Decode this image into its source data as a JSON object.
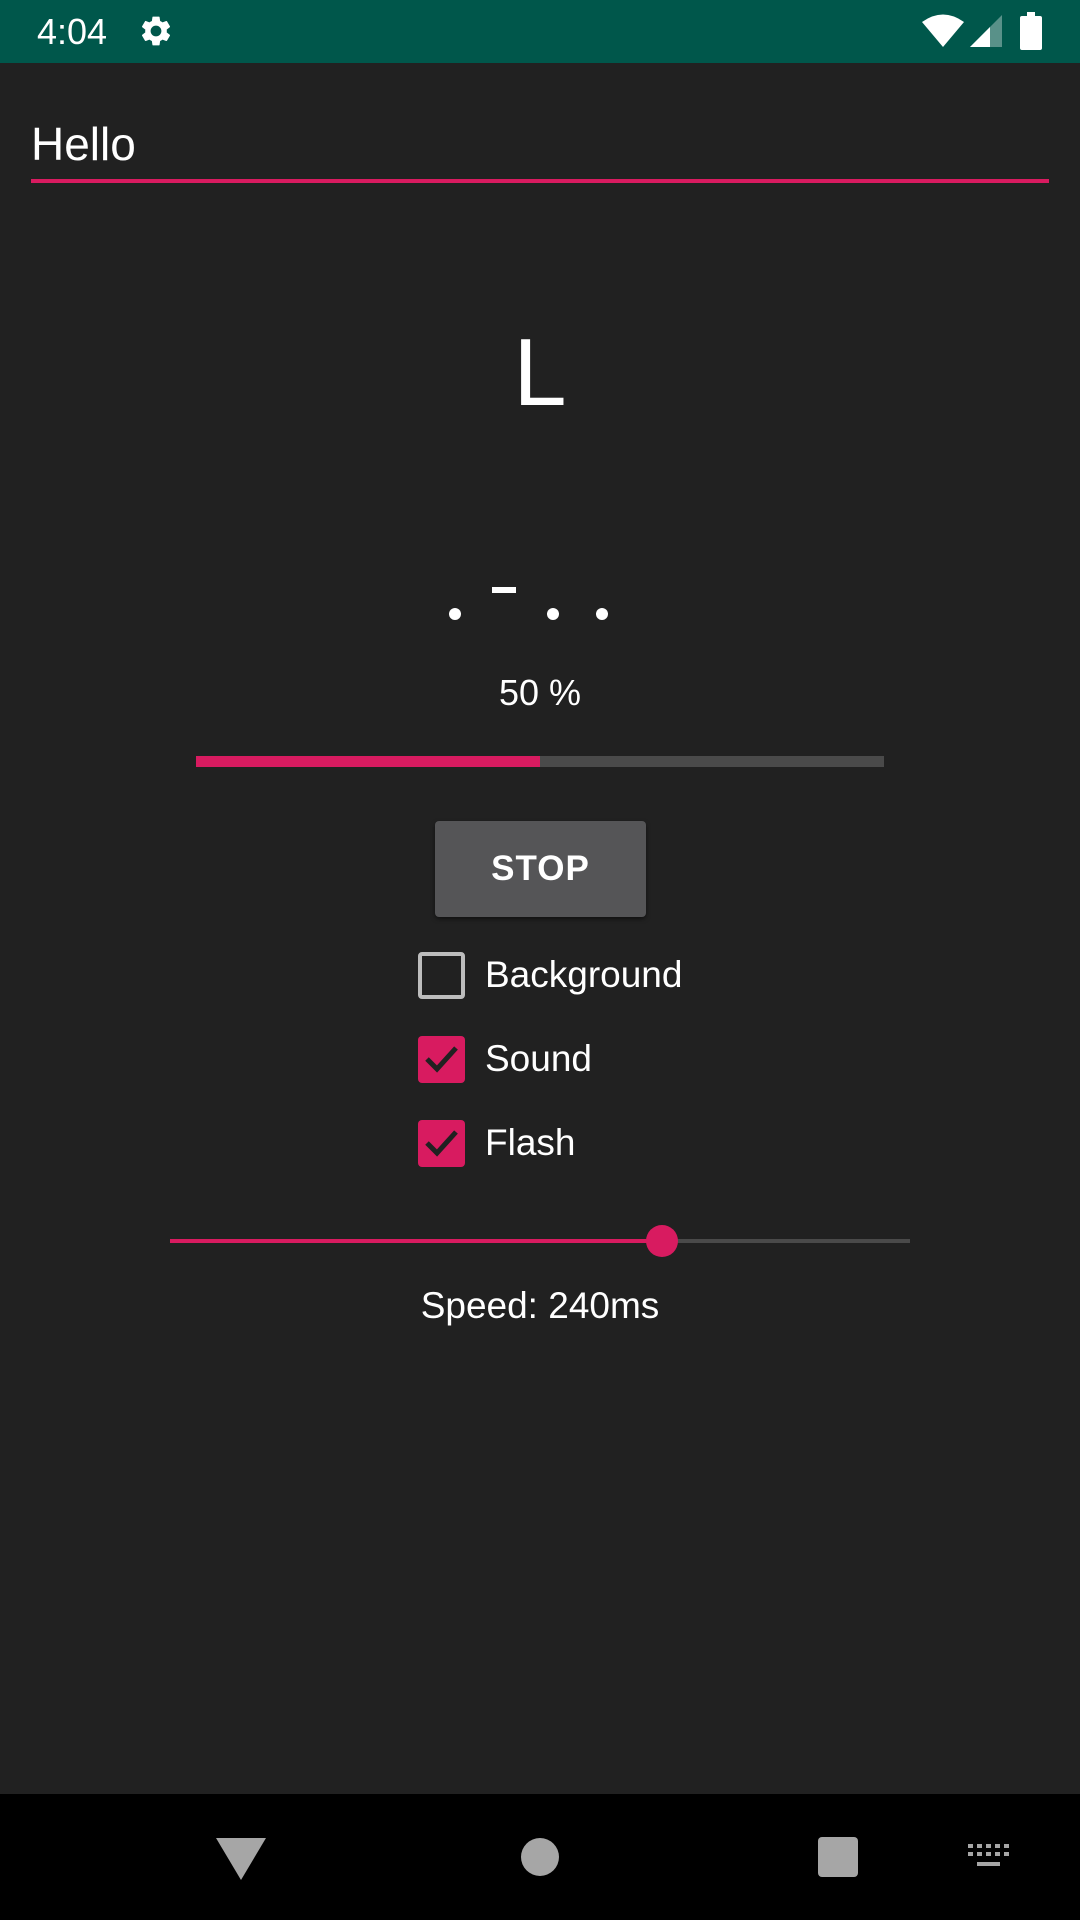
{
  "status_bar": {
    "time": "4:04",
    "icons": [
      "gear-icon",
      "wifi-icon",
      "cell-signal-icon",
      "battery-icon"
    ]
  },
  "input": {
    "value": "Hello"
  },
  "current_letter": "L",
  "morse_symbols": [
    ".",
    "-",
    ".",
    "."
  ],
  "progress": {
    "text": "50 %",
    "fraction": 0.5
  },
  "stop_button": {
    "label": "STOP"
  },
  "checkboxes": [
    {
      "label": "Background",
      "checked": false
    },
    {
      "label": "Sound",
      "checked": true
    },
    {
      "label": "Flash",
      "checked": true
    }
  ],
  "speed": {
    "text": "Speed: 240ms",
    "slider_fraction": 0.665
  },
  "nav_bar": {
    "icons": [
      "back-icon",
      "home-icon",
      "recents-icon",
      "keyboard-icon"
    ]
  },
  "colors": {
    "accent": "#d81b60",
    "status_bar": "#00574b",
    "background": "#212121",
    "button": "#555557",
    "nav_bar": "#000000"
  }
}
